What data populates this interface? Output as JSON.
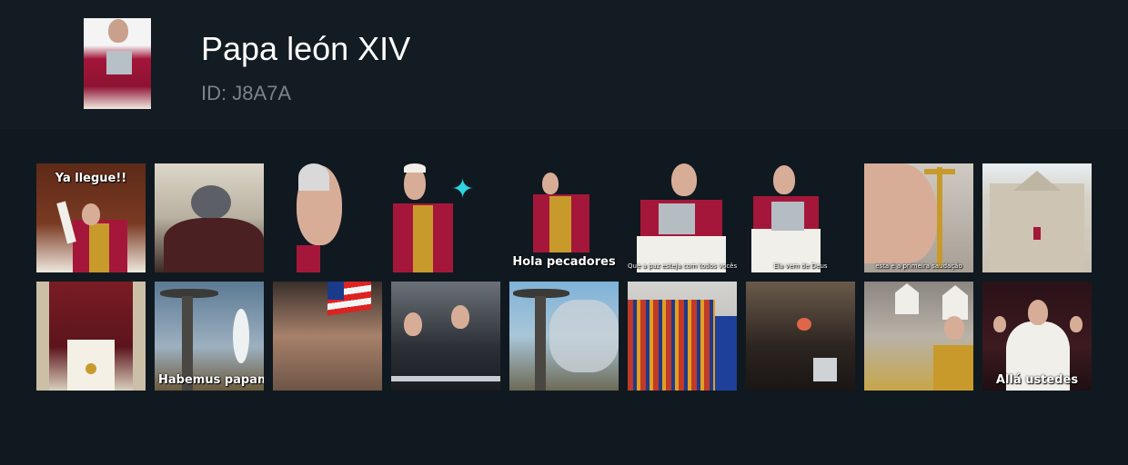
{
  "pack": {
    "title": "Papa león XIV",
    "id": "ID: J8A7A"
  },
  "stickers": [
    {
      "caption": "Ya llegue!!"
    },
    {
      "caption": ""
    },
    {
      "caption": ""
    },
    {
      "caption": ""
    },
    {
      "caption": "Hola pecadores"
    },
    {
      "caption": "Que a paz esteja com todos vocês"
    },
    {
      "caption": "Ela vem de Deus"
    },
    {
      "caption": "esta é a primeira saudação"
    },
    {
      "caption": ""
    },
    {
      "caption": ""
    },
    {
      "caption": "Habemus papam"
    },
    {
      "caption": ""
    },
    {
      "caption": ""
    },
    {
      "caption": ""
    },
    {
      "caption": ""
    },
    {
      "caption": ""
    },
    {
      "caption": ""
    },
    {
      "caption": "Allá ustedes"
    }
  ]
}
